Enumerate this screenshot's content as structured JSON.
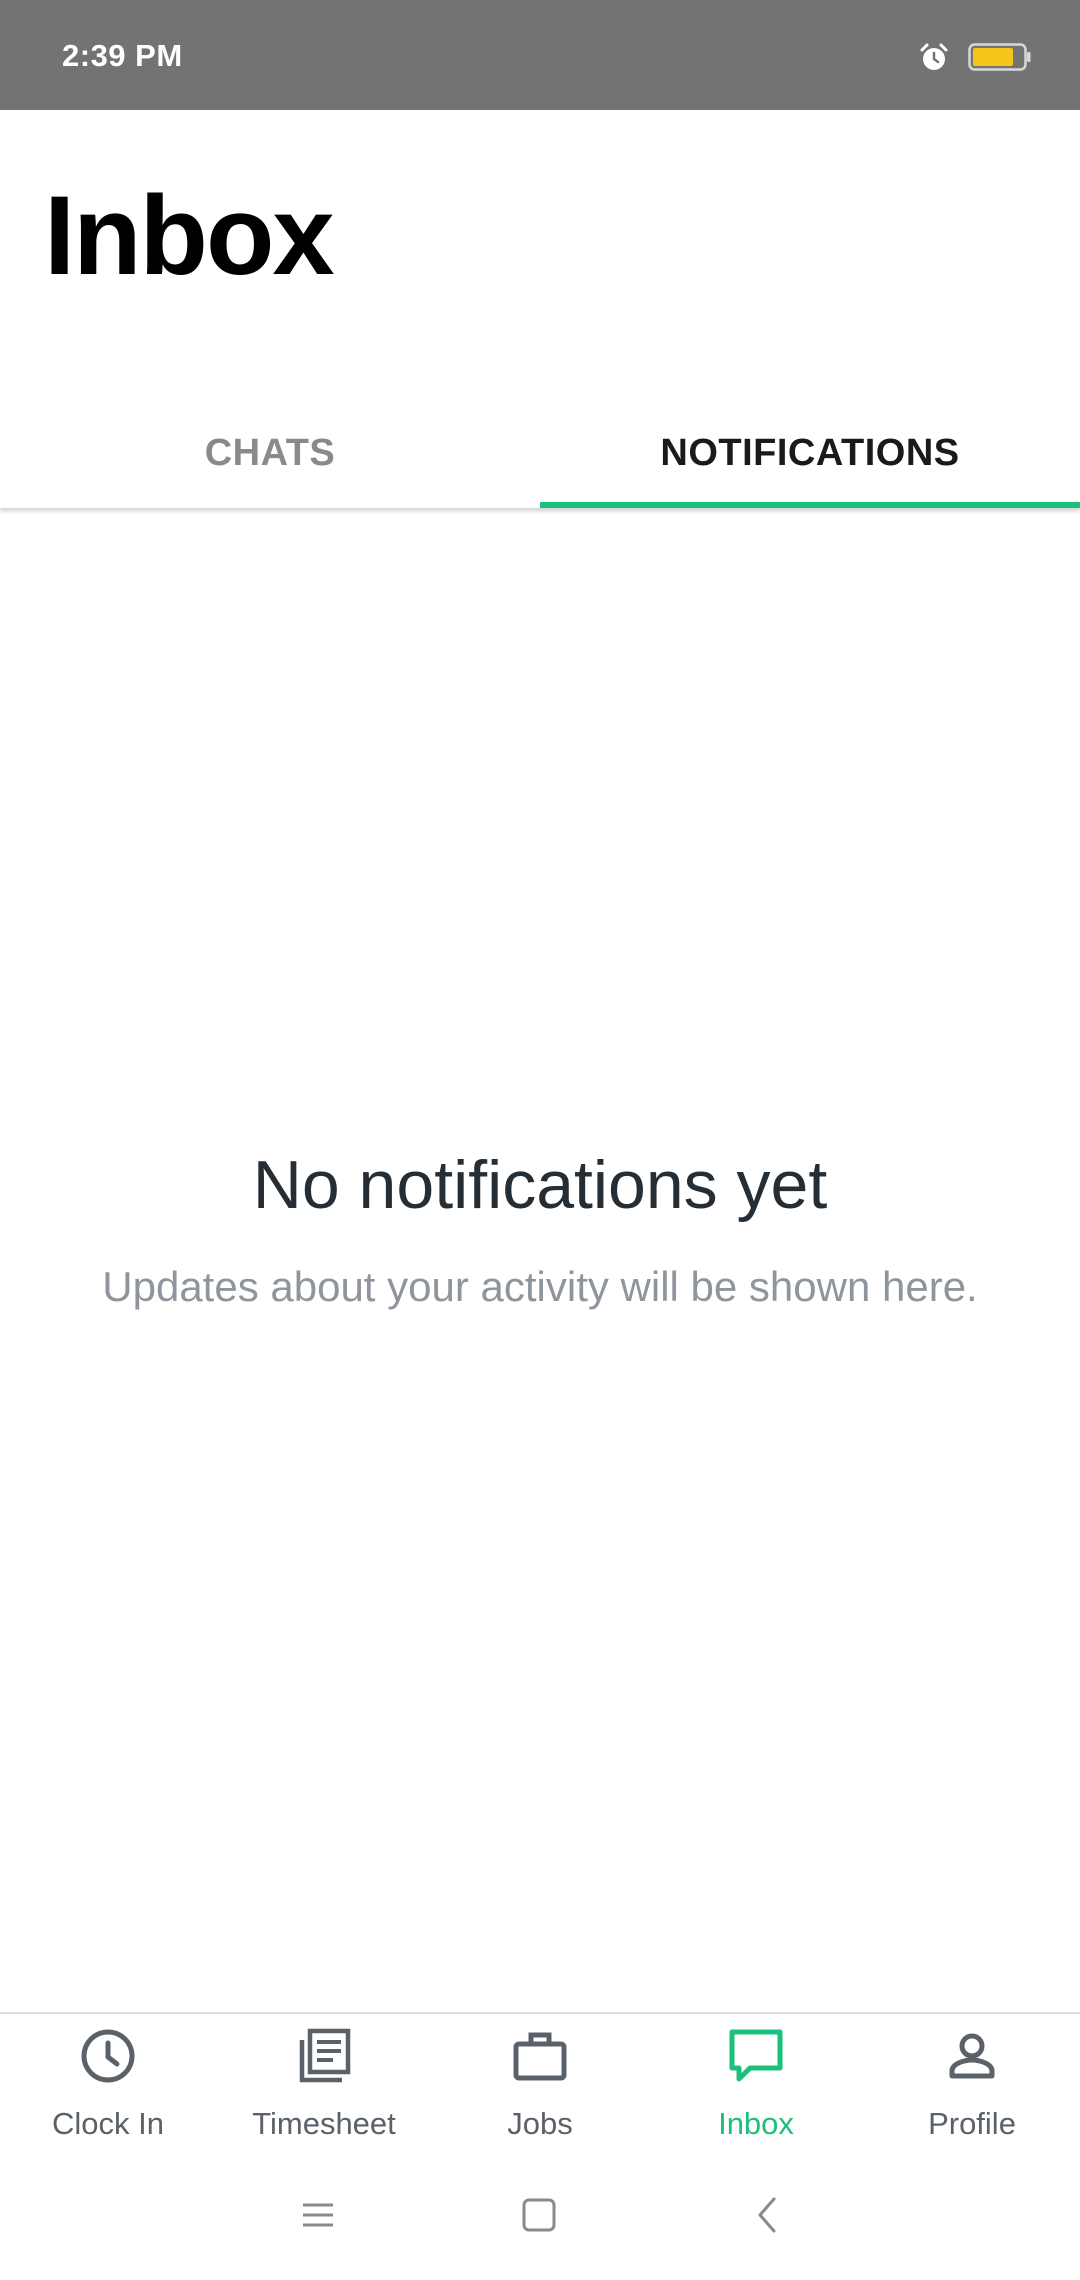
{
  "status_bar": {
    "time": "2:39 PM",
    "icons": [
      "alarm-icon",
      "battery-icon"
    ],
    "battery_color": "#f5c518"
  },
  "header": {
    "title": "Inbox"
  },
  "tabs": [
    {
      "label": "CHATS",
      "active": false
    },
    {
      "label": "NOTIFICATIONS",
      "active": true
    }
  ],
  "empty_state": {
    "title": "No notifications yet",
    "subtitle": "Updates about your activity will be shown here."
  },
  "bottom_nav": {
    "items": [
      {
        "label": "Clock In",
        "icon": "clock-icon",
        "active": false
      },
      {
        "label": "Timesheet",
        "icon": "timesheet-icon",
        "active": false
      },
      {
        "label": "Jobs",
        "icon": "briefcase-icon",
        "active": false
      },
      {
        "label": "Inbox",
        "icon": "chat-icon",
        "active": true
      },
      {
        "label": "Profile",
        "icon": "person-icon",
        "active": false
      }
    ]
  },
  "system_nav": {
    "buttons": [
      "menu-icon",
      "home-icon",
      "back-icon"
    ]
  },
  "colors": {
    "accent": "#1cc07a",
    "status_bar": "#737373",
    "title_text": "#252d35",
    "muted_text": "#8f959c"
  }
}
